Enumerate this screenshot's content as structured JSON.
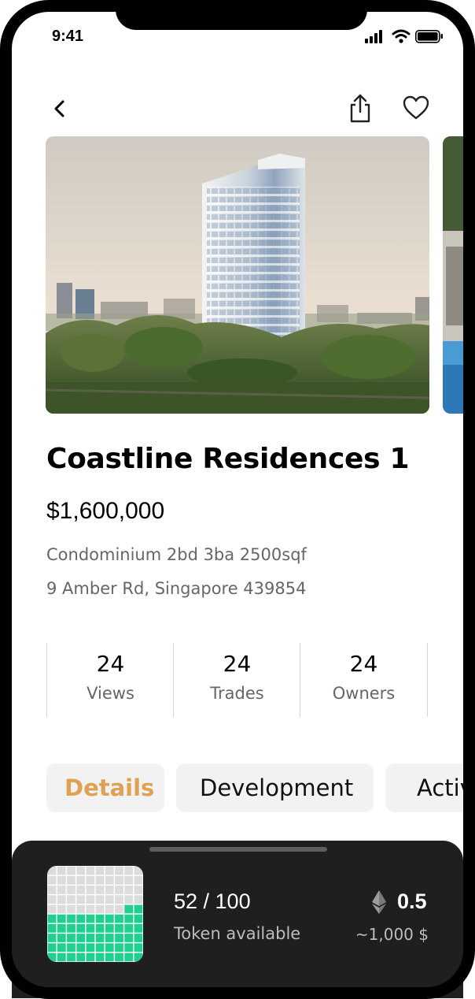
{
  "status_bar": {
    "time": "9:41",
    "icons": [
      "cellular-signal-icon",
      "wifi-icon",
      "battery-icon"
    ]
  },
  "nav": {
    "back_icon": "chevron-left-icon",
    "share_icon": "share-icon",
    "favorite_icon": "heart-icon"
  },
  "property": {
    "title": "Coastline Residences 1",
    "price": "$1,600,000",
    "details": "Condominium 2bd 3ba 2500sqf",
    "address": "9 Amber Rd, Singapore 439854"
  },
  "stats": [
    {
      "value": "24",
      "label": "Views"
    },
    {
      "value": "24",
      "label": "Trades"
    },
    {
      "value": "24",
      "label": "Owners"
    }
  ],
  "tabs": [
    {
      "label": "Details",
      "active": true
    },
    {
      "label": "Development",
      "active": false
    },
    {
      "label": "Activity",
      "active": false
    }
  ],
  "token_sheet": {
    "count": "52 / 100",
    "subtitle": "Token available",
    "tokens_available": 52,
    "tokens_total": 100,
    "eth_value": "0.5",
    "eth_icon": "ethereum-icon",
    "usd_value": "~1,000 $"
  },
  "colors": {
    "accent": "#e0a153",
    "token_fill": "#1fd08f",
    "token_empty": "#dcdcdc",
    "sheet_bg": "#1f1f1f"
  }
}
